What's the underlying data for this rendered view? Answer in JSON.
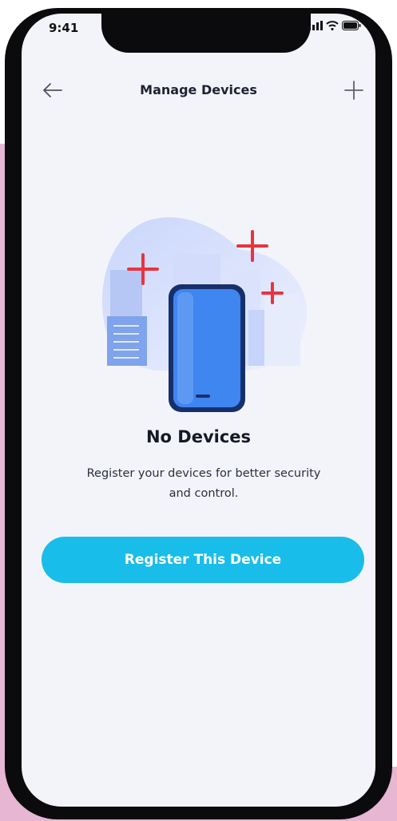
{
  "status_bar": {
    "time": "9:41",
    "icons": [
      "cellular-signal-icon",
      "wifi-icon",
      "battery-icon"
    ]
  },
  "header": {
    "title": "Manage Devices",
    "back_icon": "arrow-left-icon",
    "add_icon": "plus-icon"
  },
  "empty_state": {
    "illustration": "phone-with-sparkles-illustration",
    "title": "No Devices",
    "description": "Register your devices for better security and control.",
    "cta_label": "Register This Device"
  },
  "colors": {
    "accent": "#19BDE9",
    "screen_background": "#F3F4F9",
    "sparkle": "#E8343F",
    "phone_illustration": "#3F86F0",
    "backdrop": "#E6B6D2"
  }
}
